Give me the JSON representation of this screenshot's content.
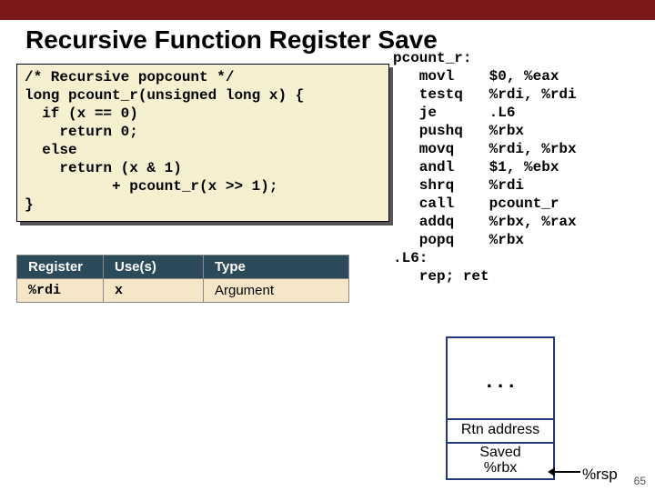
{
  "title": "Recursive Function Register Save",
  "code": "/* Recursive popcount */\nlong pcount_r(unsigned long x) {\n  if (x == 0)\n    return 0;\n  else\n    return (x & 1)\n          + pcount_r(x >> 1);\n}",
  "asm": "pcount_r:\n   movl    $0, %eax\n   testq   %rdi, %rdi\n   je      .L6\n   pushq   %rbx\n   movq    %rdi, %rbx\n   andl    $1, %ebx\n   shrq    %rdi\n   call    pcount_r\n   addq    %rbx, %rax\n   popq    %rbx\n.L6:\n   rep; ret",
  "table": {
    "headers": [
      "Register",
      "Use(s)",
      "Type"
    ],
    "rows": [
      {
        "reg": "%rdi",
        "use": "x",
        "type": "Argument"
      }
    ]
  },
  "stack": {
    "dots": ". . .",
    "cells": [
      "Rtn address",
      "Saved\n%rbx"
    ],
    "rsp": "%rsp"
  },
  "page": "65"
}
